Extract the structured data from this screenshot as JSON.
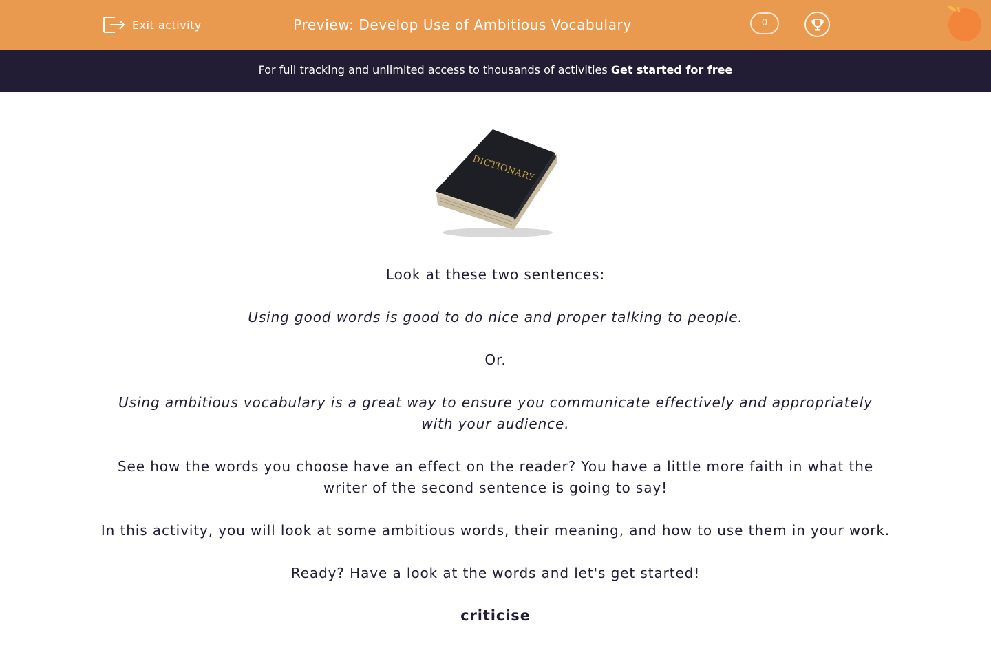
{
  "header": {
    "exit_label": "Exit activity",
    "title": "Preview: Develop Use of Ambitious Vocabulary",
    "score": "0",
    "trophy_icon": "trophy-icon",
    "logo_icon": "orange-logo-icon",
    "background_color": "#ea9a4f"
  },
  "promo": {
    "text": "For full tracking and unlimited access to thousands of activities",
    "link": "Get started for free",
    "background_color": "#231c35"
  },
  "image": {
    "label": "DICTIONARY"
  },
  "content": {
    "intro": "Look at these two sentences:",
    "sentence1": "Using good words is good to do nice and proper talking to people.",
    "or": "Or.",
    "sentence2": "Using ambitious vocabulary is a great way to ensure you communicate effectively and appropriately with your audience.",
    "paragraph1": "See how the words you choose have an effect on the reader? You have a little more faith in what the writer of the second sentence is going to say!",
    "paragraph2": "In this activity, you will look at some ambitious words, their meaning, and how to use them in your work.",
    "paragraph3": "Ready? Have a look at the words and let's get started!",
    "word": "criticise"
  }
}
